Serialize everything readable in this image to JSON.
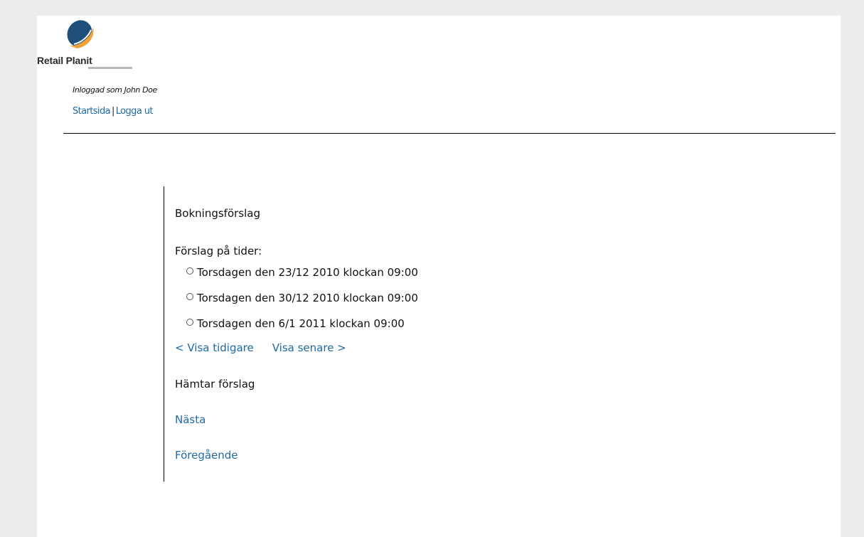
{
  "header": {
    "logo_text": "Retail Planit",
    "logged_in_text": "Inloggad som John Doe",
    "nav": {
      "home_label": "Startsida",
      "separator": "|",
      "logout_label": "Logga ut"
    }
  },
  "booking": {
    "title": "Bokningsförslag",
    "suggestions_label": "Förslag på tider:",
    "options": [
      {
        "label": "Torsdagen den 23/12 2010 klockan 09:00"
      },
      {
        "label": "Torsdagen den 30/12 2010 klockan 09:00"
      },
      {
        "label": "Torsdagen den 6/1 2011 klockan 09:00"
      }
    ],
    "show_earlier_label": "< Visa tidigare",
    "show_later_label": "Visa senare >",
    "loading_text": "Hämtar förslag",
    "next_label": "Nästa",
    "previous_label": "Föregående"
  },
  "colors": {
    "link": "#1f6aa5",
    "logo_dark_blue": "#1d4f7a",
    "logo_orange": "#f0a23a",
    "background": "#ececec"
  }
}
